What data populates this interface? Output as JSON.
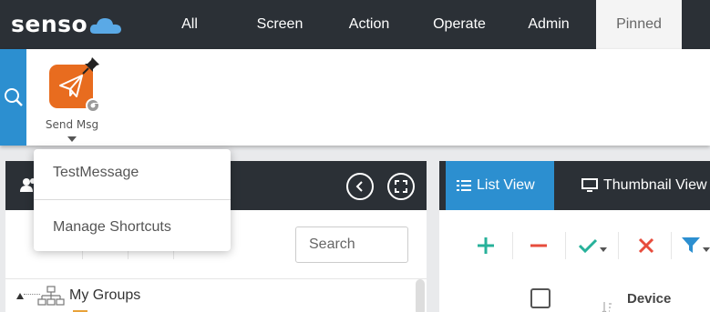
{
  "app": {
    "logo_text": "senso"
  },
  "nav": {
    "items": [
      {
        "label": "All"
      },
      {
        "label": "Screen"
      },
      {
        "label": "Action"
      },
      {
        "label": "Operate"
      },
      {
        "label": "Admin"
      },
      {
        "label": "Pinned",
        "active": true
      }
    ]
  },
  "shortcuts": {
    "items": [
      {
        "label": "Send Msg",
        "icon": "paper-plane-icon",
        "badge": "chrome-icon",
        "pinned": true
      }
    ]
  },
  "dropdown": {
    "items": [
      {
        "label": "TestMessage"
      },
      {
        "label": "Manage Shortcuts"
      }
    ]
  },
  "groups_panel": {
    "search": {
      "placeholder": "Search",
      "value": ""
    },
    "tree": {
      "root_label": "My Groups"
    }
  },
  "devices_panel": {
    "tabs": [
      {
        "label": "List View",
        "active": true
      },
      {
        "label": "Thumbnail View"
      }
    ],
    "toolbar": [
      {
        "icon": "plus-icon"
      },
      {
        "icon": "minus-icon"
      },
      {
        "icon": "check-icon"
      },
      {
        "icon": "close-icon"
      },
      {
        "icon": "filter-icon"
      }
    ],
    "columns": [
      {
        "label": "Device"
      }
    ]
  },
  "colors": {
    "topbar": "#2b3036",
    "accent_blue": "#2c8fd0",
    "shortcut_orange": "#e86c1f",
    "add_green": "#27b19a",
    "remove_red": "#e74c3c"
  }
}
